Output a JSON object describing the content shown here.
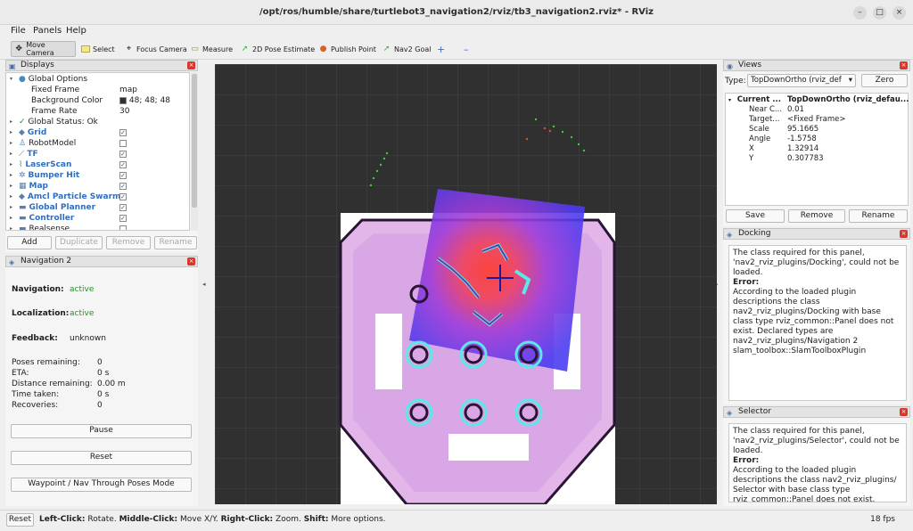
{
  "window": {
    "title": "/opt/ros/humble/share/turtlebot3_navigation2/rviz/tb3_navigation2.rviz* - RViz",
    "minimize": "–",
    "maximize": "□",
    "close": "×"
  },
  "menu": {
    "file": "File",
    "panels": "Panels",
    "help": "Help"
  },
  "toolbar": {
    "move_camera": "Move Camera",
    "select": "Select",
    "focus_camera": "Focus Camera",
    "measure": "Measure",
    "pose_estimate": "2D Pose Estimate",
    "publish_point": "Publish Point",
    "nav2_goal": "Nav2 Goal",
    "add": "+",
    "remove": "–"
  },
  "displays": {
    "title": "Displays",
    "global_options": "Global Options",
    "fixed_frame_label": "Fixed Frame",
    "fixed_frame_value": "map",
    "bg_color_label": "Background Color",
    "bg_color_value": "48; 48; 48",
    "bg_color_swatch": "#303030",
    "frame_rate_label": "Frame Rate",
    "frame_rate_value": "30",
    "global_status": "Global Status: Ok",
    "items": [
      {
        "label": "Grid",
        "checked": "✓",
        "highlight": true
      },
      {
        "label": "RobotModel",
        "checked": "",
        "highlight": false
      },
      {
        "label": "TF",
        "checked": "✓",
        "highlight": true
      },
      {
        "label": "LaserScan",
        "checked": "✓",
        "highlight": true
      },
      {
        "label": "Bumper Hit",
        "checked": "✓",
        "highlight": true
      },
      {
        "label": "Map",
        "checked": "✓",
        "highlight": true
      },
      {
        "label": "Amcl Particle Swarm",
        "checked": "✓",
        "highlight": true
      },
      {
        "label": "Global Planner",
        "checked": "✓",
        "highlight": true
      },
      {
        "label": "Controller",
        "checked": "✓",
        "highlight": true
      },
      {
        "label": "Realsense",
        "checked": "",
        "highlight": false
      }
    ],
    "buttons": {
      "add": "Add",
      "duplicate": "Duplicate",
      "remove": "Remove",
      "rename": "Rename"
    }
  },
  "nav2": {
    "title": "Navigation 2",
    "navigation_label": "Navigation:",
    "navigation_value": "active",
    "localization_label": "Localization:",
    "localization_value": "active",
    "feedback_label": "Feedback:",
    "feedback_value": "unknown",
    "stats": [
      {
        "label": "Poses remaining:",
        "value": "0"
      },
      {
        "label": "ETA:",
        "value": "0 s"
      },
      {
        "label": "Distance remaining:",
        "value": "0.00 m"
      },
      {
        "label": "Time taken:",
        "value": "0 s"
      },
      {
        "label": "Recoveries:",
        "value": "0"
      }
    ],
    "pause": "Pause",
    "reset": "Reset",
    "waypoint_mode": "Waypoint / Nav Through Poses Mode"
  },
  "views": {
    "title": "Views",
    "type_label": "Type:",
    "type_value": "TopDownOrtho (rviz_def",
    "zero": "Zero",
    "current_label": "Current ...",
    "current_value": "TopDownOrtho (rviz_defau...",
    "props": [
      {
        "label": "Near C...",
        "value": "0.01"
      },
      {
        "label": "Target...",
        "value": "<Fixed Frame>"
      },
      {
        "label": "Scale",
        "value": "95.1665"
      },
      {
        "label": "Angle",
        "value": "-1.5758"
      },
      {
        "label": "X",
        "value": "1.32914"
      },
      {
        "label": "Y",
        "value": "0.307783"
      }
    ],
    "save": "Save",
    "remove": "Remove",
    "rename": "Rename"
  },
  "docking": {
    "title": "Docking",
    "line1": "The class required for this panel, 'nav2_rviz_plugins/Docking', could not be loaded.",
    "error": "Error:",
    "line2": "According to the loaded plugin descriptions the class nav2_rviz_plugins/Docking with base class type rviz_common::Panel does not exist. Declared types are nav2_rviz_plugins/Navigation 2 slam_toolbox::SlamToolboxPlugin"
  },
  "selector": {
    "title": "Selector",
    "line1": "The class required for this panel, 'nav2_rviz_plugins/Selector', could not be loaded.",
    "error": "Error:",
    "line2": "According to the loaded plugin descriptions the class nav2_rviz_plugins/ Selector with base class type rviz_common::Panel does not exist."
  },
  "status": {
    "reset": "Reset",
    "left_click": "Left-Click:",
    "left_text": " Rotate. ",
    "middle_click": "Middle-Click:",
    "middle_text": " Move X/Y. ",
    "right_click": "Right-Click:",
    "right_text": " Zoom. ",
    "shift": "Shift:",
    "shift_text": " More options.",
    "fps": "18 fps"
  }
}
